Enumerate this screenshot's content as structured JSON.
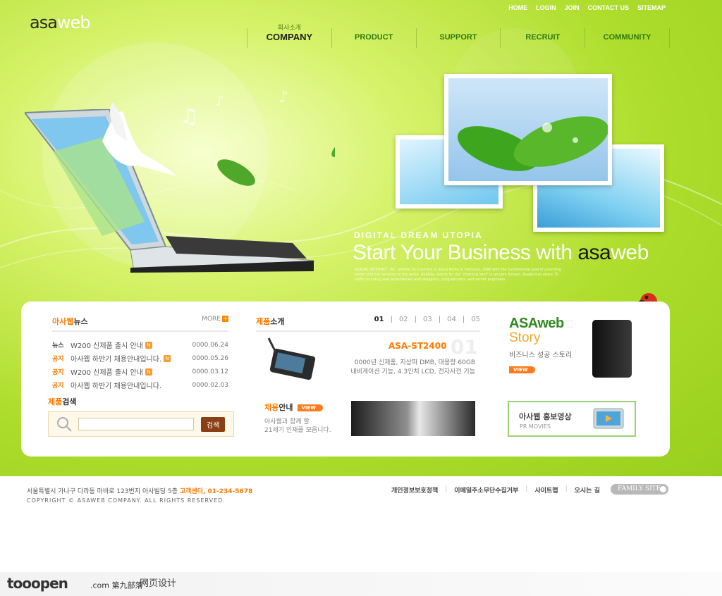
{
  "brand": {
    "logo_part1": "asa",
    "logo_part2": "web"
  },
  "util_nav": [
    "HOME",
    "LOGIN",
    "JOIN",
    "CONTACT US",
    "SITEMAP"
  ],
  "gnb": {
    "active_sub": "회사소개",
    "items": [
      "COMPANY",
      "PRODUCT",
      "SUPPORT",
      "RECRUIT",
      "COMMUNITY"
    ]
  },
  "hero": {
    "eyebrow": "DIGITAL DREAM UTOPIA",
    "headline": "Start Your Business with",
    "headline_brand1": "asa",
    "headline_brand2": "web",
    "body": "ASADAL INTERNET, INC. started its business in Seoul Korea in February, 1998 with the fundamental goal of providing better internet services to the world. ASADAL stands for the \"morning land\" in ancient Korean. Asadal has about 35 staffs including well experienced web designers, programmers, and server engineers."
  },
  "news": {
    "title_o": "아사웹",
    "title": "뉴스",
    "more": "MORE",
    "items": [
      {
        "tag": "뉴스",
        "title": "W200 신제품 출시 안내",
        "date": "0000.06.24"
      },
      {
        "tag": "공지",
        "title": "아사웹 하반기 채용안내입니다.",
        "date": "0000.05.26"
      },
      {
        "tag": "공지",
        "title": "W200 신제품 출시 안내",
        "date": "0000.03.12"
      },
      {
        "tag": "공지",
        "title": "아사웹 하반기 채용안내입니다.",
        "date": "0000.02.03"
      }
    ],
    "new_badge": "N"
  },
  "product_search": {
    "title_o": "제품",
    "title": "검색",
    "button": "검색",
    "placeholder": ""
  },
  "product": {
    "title_o": "제품",
    "title": "소개",
    "pages": [
      "01",
      "02",
      "03",
      "04",
      "05"
    ],
    "name": "ASA-ST2400",
    "num": "01",
    "desc1": "0000년 신제품, 지상파 DMB, 대용량 60GB",
    "desc2": "내비게이션 기능, 4.3인치 LCD, 전자사전 기능"
  },
  "recruit": {
    "title_o": "채용",
    "title": "안내",
    "view": "VIEW",
    "text1": "아사웹과 함께 할",
    "text2": "21세기 인재를 모읍니다."
  },
  "story": {
    "title1": "ASAweb",
    "title2": "Story",
    "sub": "비즈니스 성공 스토리",
    "view": "VIEW"
  },
  "pr_movie": {
    "title": "아사웹 홍보영상",
    "sub": "PR MOVIES"
  },
  "footer": {
    "address": "서울특별시 가나구 다라동 마바로 123번지 아사빌딩 5층",
    "cs": "고객센터, 01-234-5678",
    "copyright": "COPYRIGHT © ASAWEB COMPANY. ALL RIGHTS RESERVED.",
    "links": [
      "개인정보보호정책",
      "이메일주소무단수집거부",
      "사이트맵",
      "오시는 길"
    ],
    "family_site": "FAMILY SITE"
  },
  "watermark": {
    "logo": "tooopen",
    "suffix": ".com 第九部落",
    "tm": "™",
    "text": "网页设计"
  },
  "colors": {
    "brand_green": "#2f7a12",
    "accent_orange": "#ff7a00",
    "hero_green": "#aedd2c"
  }
}
